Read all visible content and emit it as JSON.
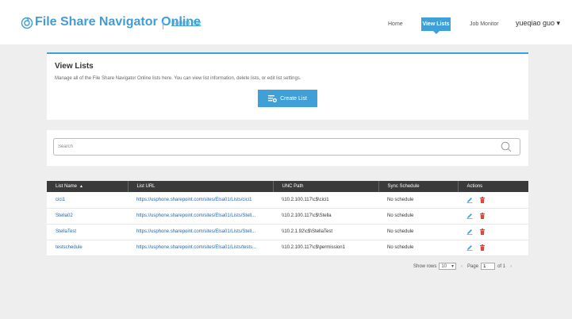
{
  "header": {
    "app_title": "File Share Navigator Online",
    "back_link": "Back to Site",
    "nav": {
      "home": "Home",
      "view_lists": "View Lists",
      "job_monitor": "Job Monitor"
    },
    "user": "yueqiao guo ▾"
  },
  "view_lists": {
    "title": "View Lists",
    "description": "Manage all of the File Share Navigator Online lists here. You can view list information, delete lists, or edit list settings.",
    "create_button": "Create List"
  },
  "search": {
    "placeholder": "Search"
  },
  "table": {
    "headers": {
      "name": "List Name",
      "url": "List URL",
      "unc": "UNC Path",
      "sync": "Sync Schedule",
      "actions": "Actions"
    },
    "sort_indicator": "▲",
    "rows": [
      {
        "name": "cici1",
        "url": "https://usphone.sharepoint.com/sites/Elsa01/Lists/cici1",
        "unc": "\\\\10.2.100.117\\c$\\cici1",
        "sync": "No schedule"
      },
      {
        "name": "Stella02",
        "url": "https://usphone.sharepoint.com/sites/Elsa01/Lists/Stell...",
        "unc": "\\\\10.2.100.117\\c$\\Stella",
        "sync": "No schedule"
      },
      {
        "name": "StellaTest",
        "url": "https://usphone.sharepoint.com/sites/Elsa01/Lists/Stell...",
        "unc": "\\\\10.2.1.92\\c$\\StellaTest",
        "sync": "No schedule"
      },
      {
        "name": "testschedule",
        "url": "https://usphone.sharepoint.com/sites/Elsa01/Lists/tests...",
        "unc": "\\\\10.2.100.117\\c$\\permission1",
        "sync": "No schedule"
      }
    ]
  },
  "pager": {
    "show_rows_label": "Show rows",
    "rows_value": "10",
    "page_label": "Page",
    "page_value": "1",
    "of_label": "of 1"
  },
  "colors": {
    "accent": "#3fa0d8",
    "header_dark": "#3a3a3a",
    "delete": "#e0453a"
  }
}
